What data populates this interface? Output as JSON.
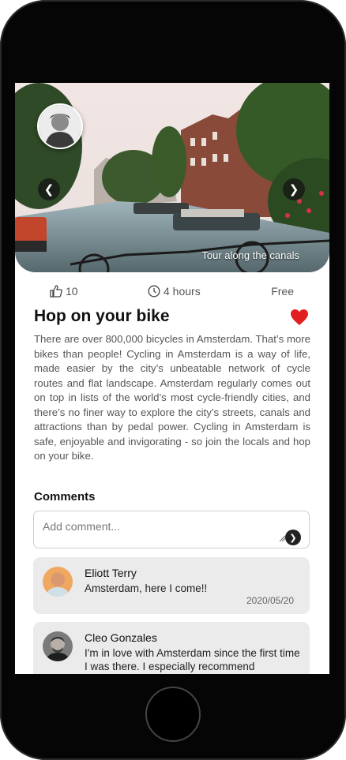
{
  "hero": {
    "caption": "Tour along the canals",
    "prev_icon": "chevron-left-icon",
    "next_icon": "chevron-right-icon"
  },
  "stats": {
    "likes": "10",
    "duration": "4 hours",
    "price": "Free"
  },
  "post": {
    "title": "Hop on your bike",
    "favorite_icon": "heart-icon",
    "favorite_color": "#e02020",
    "description": "There are over 800,000 bicycles in Amsterdam. That’s more bikes than people! Cycling in Amsterdam is a way of life, made easier by the city’s unbeatable network of cycle routes and flat landscape. Amsterdam regularly comes out on top in lists of the world’s most cycle-friendly cities, and there’s no finer way to explore the city’s streets, canals and attractions than by pedal power. Cycling in Amsterdam is safe, enjoyable and invigorating - so join the locals and hop on your bike."
  },
  "comments": {
    "title": "Comments",
    "input_placeholder": "Add comment...",
    "items": [
      {
        "name": "Eliott Terry",
        "text": "Amsterdam, here I come!!",
        "date": "2020/05/20"
      },
      {
        "name": "Cleo Gonzales",
        "text": "I'm in love with Amsterdam since the first time I was there. I especially recommend",
        "date": ""
      }
    ]
  }
}
